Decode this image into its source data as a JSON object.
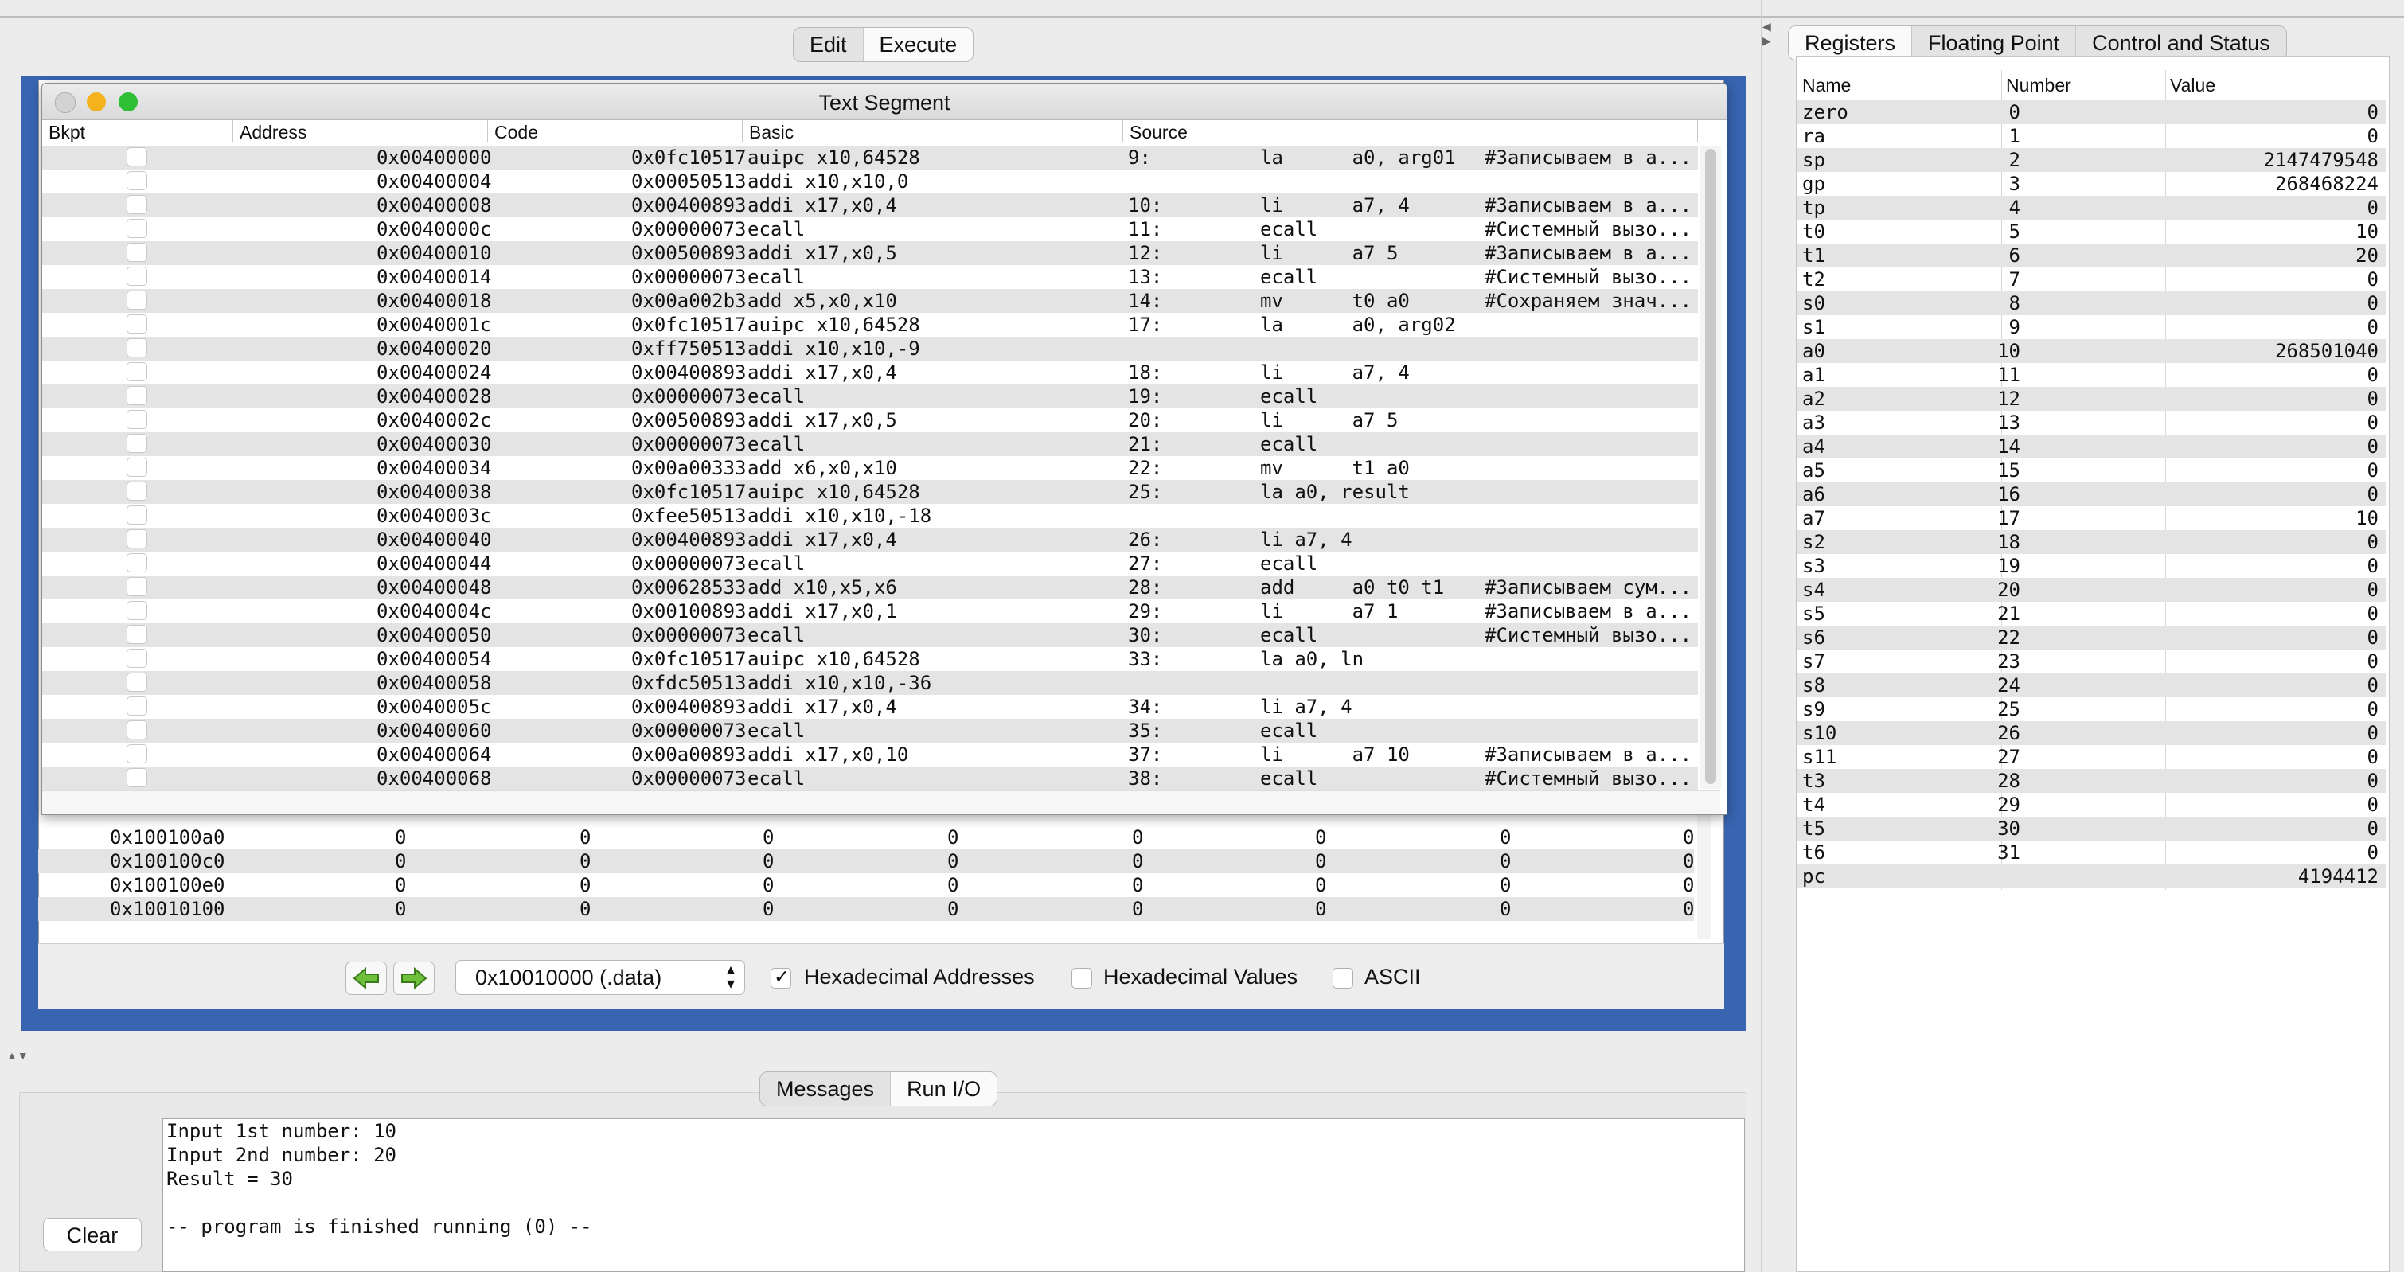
{
  "top_tabs": [
    {
      "label": "Edit",
      "active": false
    },
    {
      "label": "Execute",
      "active": true
    }
  ],
  "text_segment": {
    "title": "Text Segment",
    "columns": [
      "Bkpt",
      "Address",
      "Code",
      "Basic",
      "Source"
    ],
    "rows": [
      {
        "addr": "0x00400000",
        "code": "0x0fc10517",
        "basic": "auipc x10,64528",
        "line": "9:",
        "src": "la      a0, arg01",
        "comment": "#Записываем в а..."
      },
      {
        "addr": "0x00400004",
        "code": "0x00050513",
        "basic": "addi x10,x10,0",
        "line": "",
        "src": "",
        "comment": ""
      },
      {
        "addr": "0x00400008",
        "code": "0x00400893",
        "basic": "addi x17,x0,4",
        "line": "10:",
        "src": "li      a7, 4",
        "comment": "#Записываем в а..."
      },
      {
        "addr": "0x0040000c",
        "code": "0x00000073",
        "basic": "ecall",
        "line": "11:",
        "src": "ecall",
        "comment": "#Системный вызо..."
      },
      {
        "addr": "0x00400010",
        "code": "0x00500893",
        "basic": "addi x17,x0,5",
        "line": "12:",
        "src": "li      a7 5",
        "comment": "#Записываем в а..."
      },
      {
        "addr": "0x00400014",
        "code": "0x00000073",
        "basic": "ecall",
        "line": "13:",
        "src": "ecall",
        "comment": "#Системный вызо..."
      },
      {
        "addr": "0x00400018",
        "code": "0x00a002b3",
        "basic": "add x5,x0,x10",
        "line": "14:",
        "src": "mv      t0 a0",
        "comment": "#Сохраняем знач..."
      },
      {
        "addr": "0x0040001c",
        "code": "0x0fc10517",
        "basic": "auipc x10,64528",
        "line": "17:",
        "src": "la      a0, arg02",
        "comment": ""
      },
      {
        "addr": "0x00400020",
        "code": "0xff750513",
        "basic": "addi x10,x10,-9",
        "line": "",
        "src": "",
        "comment": ""
      },
      {
        "addr": "0x00400024",
        "code": "0x00400893",
        "basic": "addi x17,x0,4",
        "line": "18:",
        "src": "li      a7, 4",
        "comment": ""
      },
      {
        "addr": "0x00400028",
        "code": "0x00000073",
        "basic": "ecall",
        "line": "19:",
        "src": "ecall",
        "comment": ""
      },
      {
        "addr": "0x0040002c",
        "code": "0x00500893",
        "basic": "addi x17,x0,5",
        "line": "20:",
        "src": "li      a7 5",
        "comment": ""
      },
      {
        "addr": "0x00400030",
        "code": "0x00000073",
        "basic": "ecall",
        "line": "21:",
        "src": "ecall",
        "comment": ""
      },
      {
        "addr": "0x00400034",
        "code": "0x00a00333",
        "basic": "add x6,x0,x10",
        "line": "22:",
        "src": "mv      t1 a0",
        "comment": ""
      },
      {
        "addr": "0x00400038",
        "code": "0x0fc10517",
        "basic": "auipc x10,64528",
        "line": "25:",
        "src": "la a0, result",
        "comment": ""
      },
      {
        "addr": "0x0040003c",
        "code": "0xfee50513",
        "basic": "addi x10,x10,-18",
        "line": "",
        "src": "",
        "comment": ""
      },
      {
        "addr": "0x00400040",
        "code": "0x00400893",
        "basic": "addi x17,x0,4",
        "line": "26:",
        "src": "li a7, 4",
        "comment": ""
      },
      {
        "addr": "0x00400044",
        "code": "0x00000073",
        "basic": "ecall",
        "line": "27:",
        "src": "ecall",
        "comment": ""
      },
      {
        "addr": "0x00400048",
        "code": "0x00628533",
        "basic": "add x10,x5,x6",
        "line": "28:",
        "src": "add     a0 t0 t1",
        "comment": "#Записываем сум..."
      },
      {
        "addr": "0x0040004c",
        "code": "0x00100893",
        "basic": "addi x17,x0,1",
        "line": "29:",
        "src": "li      a7 1",
        "comment": "#Записываем в а..."
      },
      {
        "addr": "0x00400050",
        "code": "0x00000073",
        "basic": "ecall",
        "line": "30:",
        "src": "ecall",
        "comment": "#Системный вызо..."
      },
      {
        "addr": "0x00400054",
        "code": "0x0fc10517",
        "basic": "auipc x10,64528",
        "line": "33:",
        "src": "la a0, ln",
        "comment": ""
      },
      {
        "addr": "0x00400058",
        "code": "0xfdc50513",
        "basic": "addi x10,x10,-36",
        "line": "",
        "src": "",
        "comment": ""
      },
      {
        "addr": "0x0040005c",
        "code": "0x00400893",
        "basic": "addi x17,x0,4",
        "line": "34:",
        "src": "li a7, 4",
        "comment": ""
      },
      {
        "addr": "0x00400060",
        "code": "0x00000073",
        "basic": "ecall",
        "line": "35:",
        "src": "ecall",
        "comment": ""
      },
      {
        "addr": "0x00400064",
        "code": "0x00a00893",
        "basic": "addi x17,x0,10",
        "line": "37:",
        "src": "li      a7 10",
        "comment": "#Записываем в а..."
      },
      {
        "addr": "0x00400068",
        "code": "0x00000073",
        "basic": "ecall",
        "line": "38:",
        "src": "ecall",
        "comment": "#Системный вызо..."
      }
    ]
  },
  "data_segment": {
    "rows": [
      {
        "addr": "0x100100a0",
        "vals": [
          "0",
          "0",
          "0",
          "0",
          "0",
          "0",
          "0",
          "0"
        ]
      },
      {
        "addr": "0x100100c0",
        "vals": [
          "0",
          "0",
          "0",
          "0",
          "0",
          "0",
          "0",
          "0"
        ]
      },
      {
        "addr": "0x100100e0",
        "vals": [
          "0",
          "0",
          "0",
          "0",
          "0",
          "0",
          "0",
          "0"
        ]
      },
      {
        "addr": "0x10010100",
        "vals": [
          "0",
          "0",
          "0",
          "0",
          "0",
          "0",
          "0",
          "0"
        ]
      }
    ],
    "segment_select": "0x10010000 (.data)",
    "hex_addresses_label": "Hexadecimal Addresses",
    "hex_addresses_checked": true,
    "hex_values_label": "Hexadecimal Values",
    "hex_values_checked": false,
    "ascii_label": "ASCII",
    "ascii_checked": false
  },
  "register_tabs": [
    {
      "label": "Registers",
      "active": true
    },
    {
      "label": "Floating Point",
      "active": false
    },
    {
      "label": "Control and Status",
      "active": false
    }
  ],
  "registers": {
    "columns": [
      "Name",
      "Number",
      "Value"
    ],
    "rows": [
      {
        "name": "zero",
        "num": "0",
        "val": "0"
      },
      {
        "name": "ra",
        "num": "1",
        "val": "0"
      },
      {
        "name": "sp",
        "num": "2",
        "val": "2147479548"
      },
      {
        "name": "gp",
        "num": "3",
        "val": "268468224"
      },
      {
        "name": "tp",
        "num": "4",
        "val": "0"
      },
      {
        "name": "t0",
        "num": "5",
        "val": "10"
      },
      {
        "name": "t1",
        "num": "6",
        "val": "20"
      },
      {
        "name": "t2",
        "num": "7",
        "val": "0"
      },
      {
        "name": "s0",
        "num": "8",
        "val": "0"
      },
      {
        "name": "s1",
        "num": "9",
        "val": "0"
      },
      {
        "name": "a0",
        "num": "10",
        "val": "268501040"
      },
      {
        "name": "a1",
        "num": "11",
        "val": "0"
      },
      {
        "name": "a2",
        "num": "12",
        "val": "0"
      },
      {
        "name": "a3",
        "num": "13",
        "val": "0"
      },
      {
        "name": "a4",
        "num": "14",
        "val": "0"
      },
      {
        "name": "a5",
        "num": "15",
        "val": "0"
      },
      {
        "name": "a6",
        "num": "16",
        "val": "0"
      },
      {
        "name": "a7",
        "num": "17",
        "val": "10"
      },
      {
        "name": "s2",
        "num": "18",
        "val": "0"
      },
      {
        "name": "s3",
        "num": "19",
        "val": "0"
      },
      {
        "name": "s4",
        "num": "20",
        "val": "0"
      },
      {
        "name": "s5",
        "num": "21",
        "val": "0"
      },
      {
        "name": "s6",
        "num": "22",
        "val": "0"
      },
      {
        "name": "s7",
        "num": "23",
        "val": "0"
      },
      {
        "name": "s8",
        "num": "24",
        "val": "0"
      },
      {
        "name": "s9",
        "num": "25",
        "val": "0"
      },
      {
        "name": "s10",
        "num": "26",
        "val": "0"
      },
      {
        "name": "s11",
        "num": "27",
        "val": "0"
      },
      {
        "name": "t3",
        "num": "28",
        "val": "0"
      },
      {
        "name": "t4",
        "num": "29",
        "val": "0"
      },
      {
        "name": "t5",
        "num": "30",
        "val": "0"
      },
      {
        "name": "t6",
        "num": "31",
        "val": "0"
      },
      {
        "name": "pc",
        "num": "",
        "val": "4194412"
      }
    ]
  },
  "message_tabs": [
    {
      "label": "Messages",
      "active": false
    },
    {
      "label": "Run I/O",
      "active": true
    }
  ],
  "run_io": {
    "lines": [
      "Input 1st number: 10",
      "Input 2nd number: 20",
      "Result = 30",
      "",
      "-- program is finished running (0) --"
    ],
    "clear_label": "Clear"
  },
  "colors": {
    "frame_blue": "#3864b0",
    "row_alt": "#e4e4e4"
  }
}
